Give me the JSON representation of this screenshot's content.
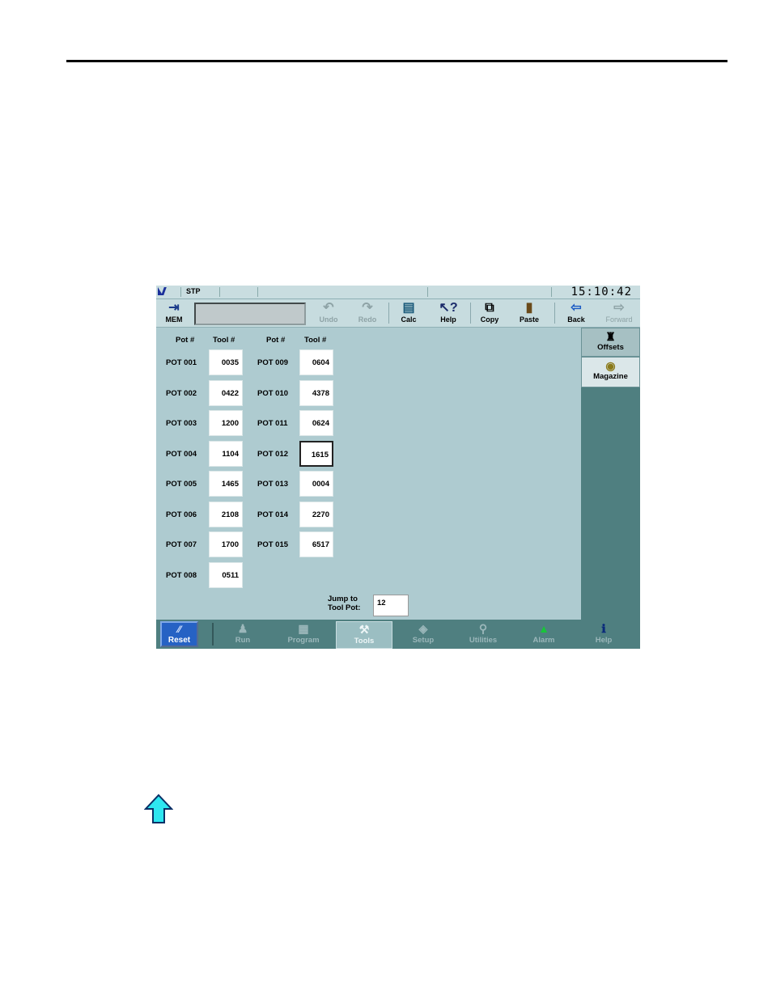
{
  "status": {
    "mode": "STP",
    "clock": "15:10:42"
  },
  "toolbar": {
    "mem": "MEM",
    "undo": "Undo",
    "redo": "Redo",
    "calc": "Calc",
    "help": "Help",
    "copy": "Copy",
    "paste": "Paste",
    "back": "Back",
    "forward": "Forward"
  },
  "side_tabs": {
    "offsets": "Offsets",
    "magazine": "Magazine"
  },
  "table": {
    "pot_header": "Pot #",
    "tool_header": "Tool #",
    "rows": [
      {
        "pot": "POT 001",
        "tool": "0035"
      },
      {
        "pot": "POT 002",
        "tool": "0422"
      },
      {
        "pot": "POT 003",
        "tool": "1200"
      },
      {
        "pot": "POT 004",
        "tool": "1104"
      },
      {
        "pot": "POT 005",
        "tool": "1465"
      },
      {
        "pot": "POT 006",
        "tool": "2108"
      },
      {
        "pot": "POT 007",
        "tool": "1700"
      },
      {
        "pot": "POT 008",
        "tool": "0511"
      },
      {
        "pot": "POT 009",
        "tool": "0604"
      },
      {
        "pot": "POT 010",
        "tool": "4378"
      },
      {
        "pot": "POT 011",
        "tool": "0624"
      },
      {
        "pot": "POT 012",
        "tool": "1615"
      },
      {
        "pot": "POT 013",
        "tool": "0004"
      },
      {
        "pot": "POT 014",
        "tool": "2270"
      },
      {
        "pot": "POT 015",
        "tool": "6517"
      }
    ],
    "selected_pot": "POT 012"
  },
  "jump": {
    "label_line1": "Jump to",
    "label_line2": "Tool Pot:",
    "value": "12"
  },
  "nav": {
    "reset": "Reset",
    "items": [
      "Run",
      "Program",
      "Tools",
      "Setup",
      "Utilities",
      "Alarm",
      "Help"
    ],
    "active": "Tools"
  },
  "colors": {
    "screen_bg": "#aecbd0",
    "nav_bg": "#4f7f80",
    "reset_bg": "#2662c4",
    "arrow": "#2ee6f0"
  },
  "icons": [
    "mem-icon",
    "undo-icon",
    "redo-icon",
    "calc-icon",
    "help-cursor-icon",
    "copy-icon",
    "paste-icon",
    "back-arrow-icon",
    "forward-arrow-icon",
    "offsets-icon",
    "magazine-icon",
    "run-icon",
    "program-icon",
    "tools-icon",
    "setup-icon",
    "utilities-wrench-icon",
    "alarm-light-icon",
    "help-info-icon",
    "up-arrow-icon"
  ]
}
